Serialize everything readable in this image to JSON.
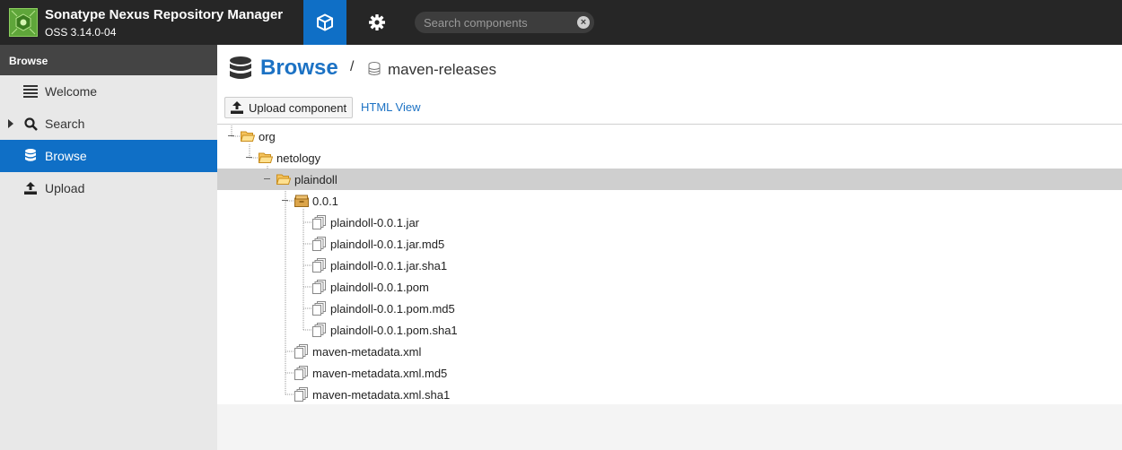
{
  "app": {
    "title": "Sonatype Nexus Repository Manager",
    "version": "OSS 3.14.0-04"
  },
  "header": {
    "search_placeholder": "Search components",
    "browse_icon": "cube-icon",
    "admin_icon": "gear-icon"
  },
  "sidebar": {
    "header": "Browse",
    "items": [
      {
        "label": "Welcome",
        "icon": "list-icon",
        "active": false
      },
      {
        "label": "Search",
        "icon": "search-icon",
        "active": false
      },
      {
        "label": "Browse",
        "icon": "database-icon",
        "active": true
      },
      {
        "label": "Upload",
        "icon": "upload-icon",
        "active": false
      }
    ]
  },
  "main": {
    "title": "Browse",
    "breadcrumb_separator": "/",
    "repository": "maven-releases",
    "upload_button": "Upload component",
    "html_view_link": "HTML View"
  },
  "tree": [
    {
      "label": "org",
      "type": "folder-open"
    },
    {
      "label": "netology",
      "type": "folder-open"
    },
    {
      "label": "plaindoll",
      "type": "folder-open",
      "selected": true
    },
    {
      "label": "0.0.1",
      "type": "component"
    },
    {
      "label": "plaindoll-0.0.1.jar",
      "type": "file"
    },
    {
      "label": "plaindoll-0.0.1.jar.md5",
      "type": "file"
    },
    {
      "label": "plaindoll-0.0.1.jar.sha1",
      "type": "file"
    },
    {
      "label": "plaindoll-0.0.1.pom",
      "type": "file"
    },
    {
      "label": "plaindoll-0.0.1.pom.md5",
      "type": "file"
    },
    {
      "label": "plaindoll-0.0.1.pom.sha1",
      "type": "file"
    },
    {
      "label": "maven-metadata.xml",
      "type": "file"
    },
    {
      "label": "maven-metadata.xml.md5",
      "type": "file"
    },
    {
      "label": "maven-metadata.xml.sha1",
      "type": "file"
    }
  ],
  "colors": {
    "accent": "#0f6fc6",
    "header_bg": "#262626",
    "title": "#1c72c4",
    "selected_row": "#cfcfcf"
  }
}
